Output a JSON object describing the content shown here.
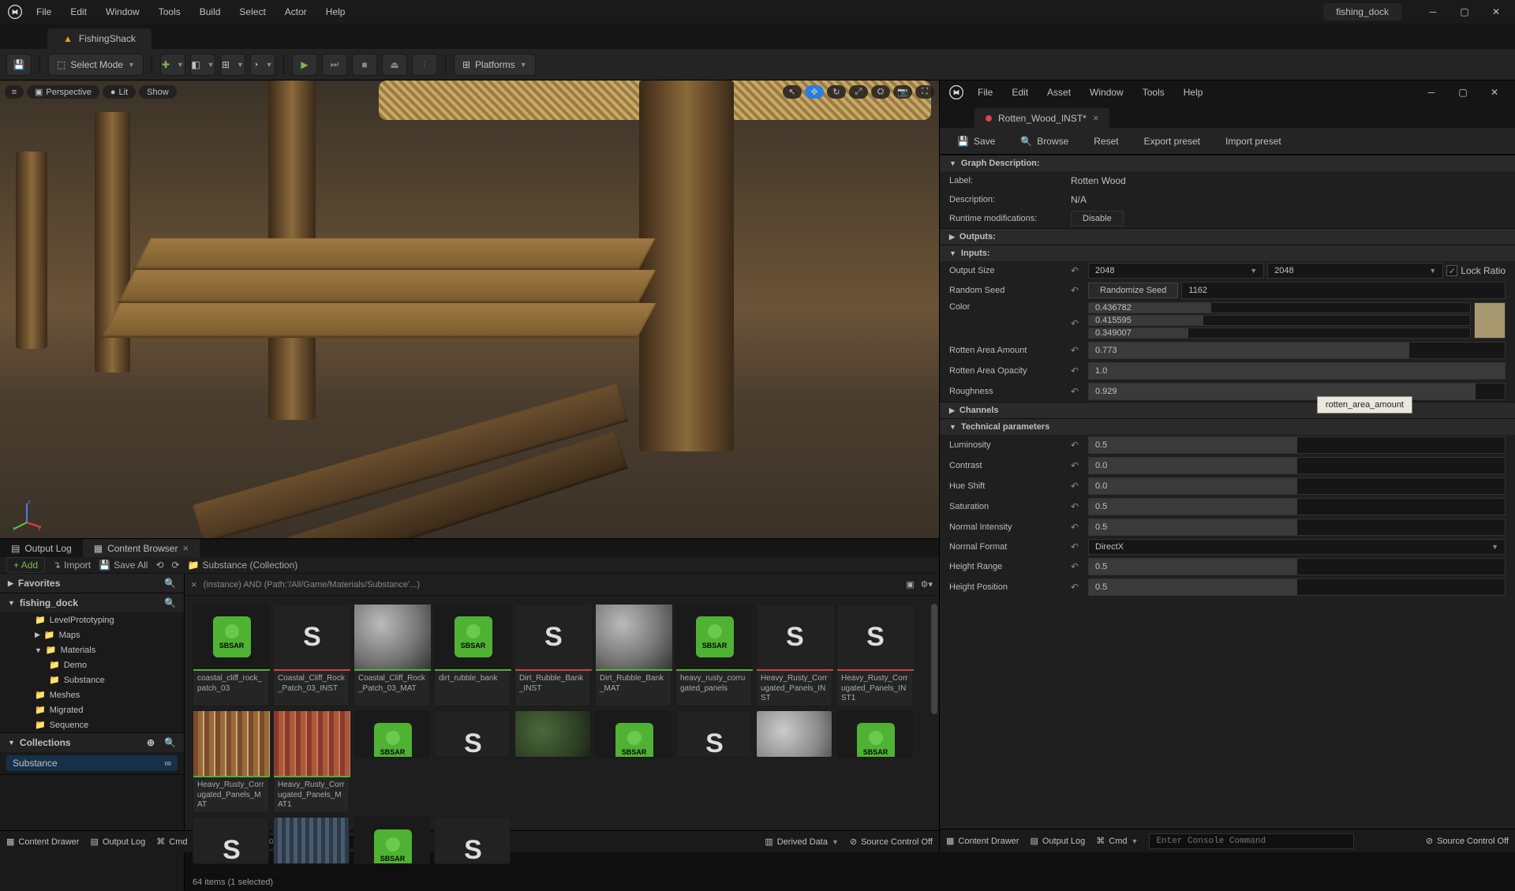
{
  "main_menu": [
    "File",
    "Edit",
    "Window",
    "Tools",
    "Build",
    "Select",
    "Actor",
    "Help"
  ],
  "project_name": "fishing_dock",
  "main_tab": "FishingShack",
  "toolbar": {
    "select_mode": "Select Mode",
    "platforms": "Platforms"
  },
  "viewport": {
    "perspective": "Perspective",
    "lit": "Lit",
    "show": "Show"
  },
  "bottom_tabs": {
    "output_log": "Output Log",
    "content_browser": "Content Browser"
  },
  "browser_toolbar": {
    "add": "Add",
    "import": "Import",
    "save_all": "Save All",
    "path": "Substance (Collection)"
  },
  "sidebar": {
    "favorites": "Favorites",
    "project": "fishing_dock",
    "tree": [
      "LevelPrototyping",
      "Maps",
      "Materials",
      "Demo",
      "Substance",
      "Meshes",
      "Migrated",
      "Sequence"
    ],
    "collections": "Collections",
    "collection_item": "Substance"
  },
  "filter_text": "(instance) AND (Path:'/All/Game/Materials/Substance'...)",
  "assets_row1": [
    {
      "type": "sbsar",
      "label": "coastal_cliff_rock_patch_03",
      "u": "green"
    },
    {
      "type": "inst",
      "label": "Coastal_Cliff_Rock_Patch_03_INST",
      "u": "red"
    },
    {
      "type": "sphere",
      "label": "Coastal_Cliff_Rock_Patch_03_MAT",
      "u": "green"
    },
    {
      "type": "sbsar",
      "label": "dirt_rubble_bank",
      "u": "green"
    },
    {
      "type": "inst",
      "label": "Dirt_Rubble_Bank_INST",
      "u": "red"
    },
    {
      "type": "sphere",
      "label": "Dirt_Rubble_Bank_MAT",
      "u": "green"
    },
    {
      "type": "sbsar",
      "label": "heavy_rusty_corrugated_panels",
      "u": "green"
    },
    {
      "type": "inst",
      "label": "Heavy_Rusty_Corrugated_Panels_INST",
      "u": "red"
    },
    {
      "type": "inst",
      "label": "Heavy_Rusty_Corrugated_Panels_INST1",
      "u": "red"
    },
    {
      "type": "rust",
      "label": "Heavy_Rusty_Corrugated_Panels_MAT",
      "u": "green"
    },
    {
      "type": "rust2",
      "label": "Heavy_Rusty_Corrugated_Panels_MAT1",
      "u": "green"
    }
  ],
  "assets_row2": [
    {
      "type": "sbsar"
    },
    {
      "type": "inst"
    },
    {
      "type": "sphere_g"
    },
    {
      "type": "sbsar"
    },
    {
      "type": "inst"
    },
    {
      "type": "sphere_b"
    },
    {
      "type": "sbsar"
    },
    {
      "type": "inst"
    },
    {
      "type": "metal"
    },
    {
      "type": "sbsar"
    },
    {
      "type": "inst"
    }
  ],
  "grid_footer": "64 items (1 selected)",
  "statusbar": {
    "content_drawer": "Content Drawer",
    "output_log": "Output Log",
    "cmd": "Cmd",
    "cmd_placeholder": "Enter Console Command",
    "derived": "Derived Data",
    "source_control": "Source Control Off"
  },
  "substance": {
    "menu": [
      "File",
      "Edit",
      "Asset",
      "Window",
      "Tools",
      "Help"
    ],
    "tab": "Rotten_Wood_INST*",
    "toolbar": {
      "save": "Save",
      "browse": "Browse",
      "reset": "Reset",
      "export": "Export preset",
      "import": "Import preset"
    },
    "graph": {
      "header": "Graph Description:",
      "label_k": "Label:",
      "label_v": "Rotten Wood",
      "desc_k": "Description:",
      "desc_v": "N/A",
      "runtime_k": "Runtime modifications:",
      "disable": "Disable"
    },
    "outputs_header": "Outputs:",
    "inputs_header": "Inputs:",
    "output_size": {
      "label": "Output Size",
      "w": "2048",
      "h": "2048",
      "lock": "Lock Ratio"
    },
    "random_seed": {
      "label": "Random Seed",
      "btn": "Randomize Seed",
      "value": "1162"
    },
    "color": {
      "label": "Color",
      "r": "0.436782",
      "g": "0.415595",
      "b": "0.349007"
    },
    "rotten_amount": {
      "label": "Rotten Area Amount",
      "value": "0.773"
    },
    "rotten_opacity": {
      "label": "Rotten Area Opacity",
      "value": "1.0"
    },
    "roughness": {
      "label": "Roughness",
      "value": "0.929"
    },
    "channels_header": "Channels",
    "technical_header": "Technical parameters",
    "luminosity": {
      "label": "Luminosity",
      "value": "0.5"
    },
    "contrast": {
      "label": "Contrast",
      "value": "0.0"
    },
    "hue_shift": {
      "label": "Hue Shift",
      "value": "0.0"
    },
    "saturation": {
      "label": "Saturation",
      "value": "0.5"
    },
    "normal_intensity": {
      "label": "Normal Intensity",
      "value": "0.5"
    },
    "normal_format": {
      "label": "Normal Format",
      "value": "DirectX"
    },
    "height_range": {
      "label": "Height Range",
      "value": "0.5"
    },
    "height_position": {
      "label": "Height Position",
      "value": "0.5"
    },
    "tooltip": "rotten_area_amount"
  }
}
